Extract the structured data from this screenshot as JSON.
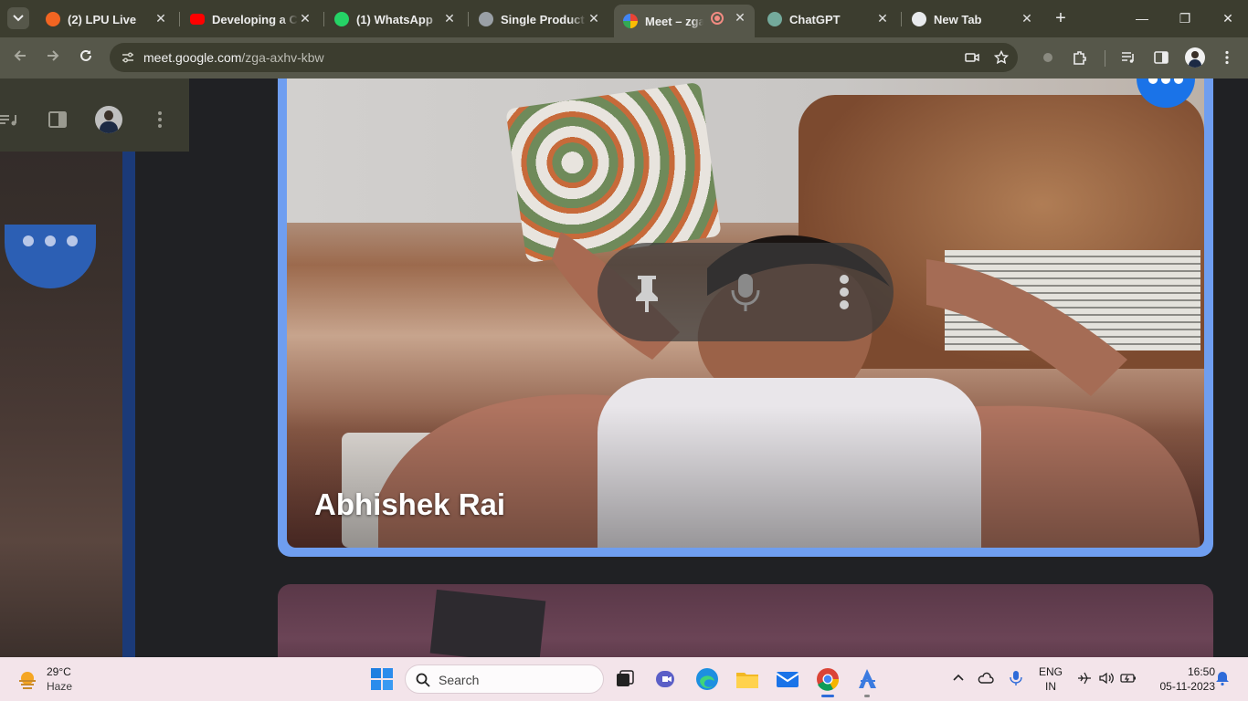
{
  "browser": {
    "tabs": [
      {
        "title": "(2) LPU Live",
        "color": "#f26522"
      },
      {
        "title": "Developing a Co",
        "color": "#ff0000"
      },
      {
        "title": "(1) WhatsApp",
        "color": "#25d366"
      },
      {
        "title": "Single Product P",
        "color": "#9aa0a6"
      },
      {
        "title": "Meet – zga-axhv-kbw",
        "color": "#34a853",
        "active": true
      },
      {
        "title": "ChatGPT",
        "color": "#74aa9c"
      },
      {
        "title": "New Tab",
        "color": "#e8eaed"
      }
    ],
    "close_symbol": "✕",
    "new_tab_symbol": "+",
    "window_controls": [
      "—",
      "❐",
      "✕"
    ],
    "url_host": "meet.google.com",
    "url_path": "/zga-axhv-kbw"
  },
  "meet": {
    "participant_name": "Abhishek Rai",
    "accent": "#1a73e8",
    "tile_border": "#6f9ef0",
    "hover_controls": [
      "pin-icon",
      "microphone-icon",
      "more-vert-icon"
    ]
  },
  "taskbar": {
    "weather_temp": "29°C",
    "weather_condition": "Haze",
    "search_placeholder": "Search",
    "language_top": "ENG",
    "language_bottom": "IN",
    "time": "16:50",
    "date": "05-11-2023"
  }
}
